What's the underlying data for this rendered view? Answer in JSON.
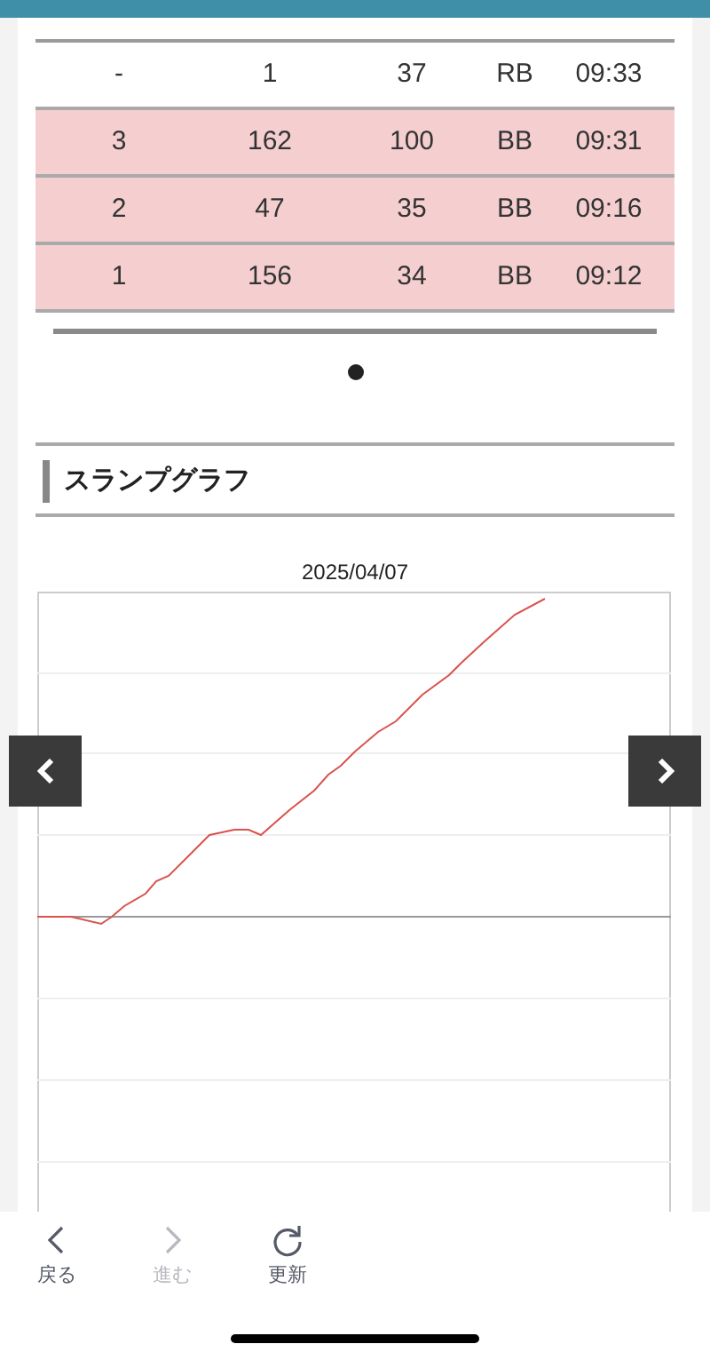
{
  "table": {
    "rows": [
      {
        "cells": [
          "-",
          "1",
          "37",
          "RB",
          "09:33"
        ],
        "highlighted": false
      },
      {
        "cells": [
          "3",
          "162",
          "100",
          "BB",
          "09:31"
        ],
        "highlighted": true
      },
      {
        "cells": [
          "2",
          "47",
          "35",
          "BB",
          "09:16"
        ],
        "highlighted": true
      },
      {
        "cells": [
          "1",
          "156",
          "34",
          "BB",
          "09:12"
        ],
        "highlighted": true
      }
    ]
  },
  "pager": {
    "dots": [
      {
        "selected": true
      }
    ]
  },
  "section": {
    "title": "スランプグラフ"
  },
  "graph": {
    "title": "2025/04/07"
  },
  "toolbar": {
    "buttons": [
      {
        "kind": "back",
        "label": "戻る",
        "disabled": false
      },
      {
        "kind": "forward",
        "label": "進む",
        "disabled": true
      },
      {
        "kind": "reload",
        "label": "更新",
        "disabled": false
      }
    ]
  }
}
